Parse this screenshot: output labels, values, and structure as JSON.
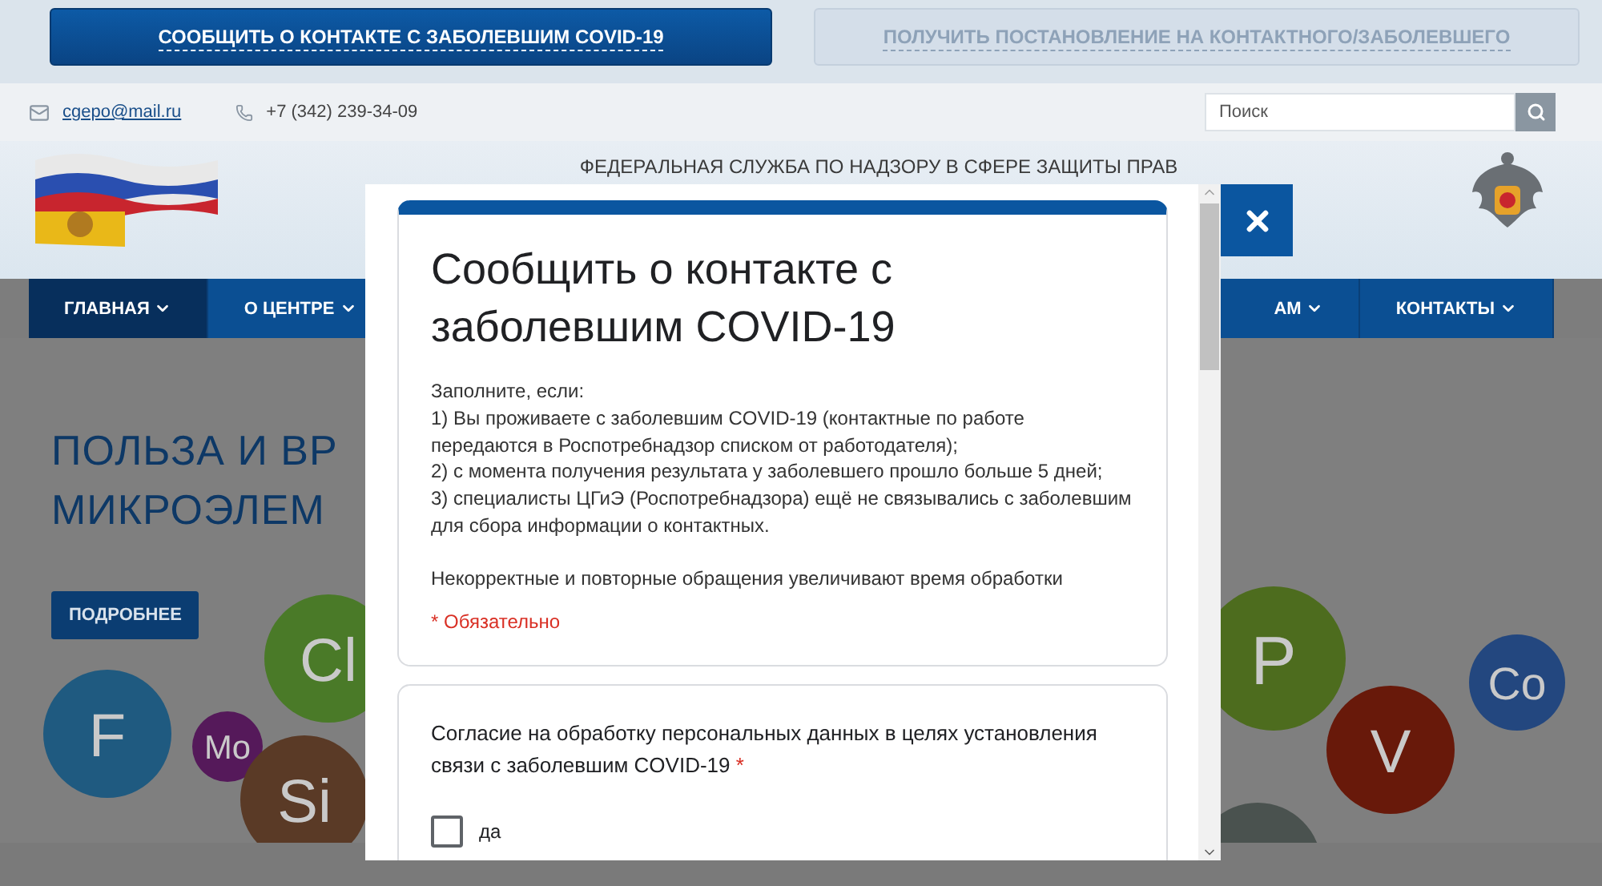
{
  "top_buttons": [
    {
      "label": "СООБЩИТЬ О КОНТАКТЕ С ЗАБОЛЕВШИМ COVID-19",
      "selected": true
    },
    {
      "label": "ПОЛУЧИТЬ ПОСТАНОВЛЕНИЕ НА КОНТАКТНОГО/ЗАБОЛЕВШЕГО",
      "selected": false
    }
  ],
  "contacts": {
    "email": "cgepo@mail.ru",
    "phone": "+7 (342) 239-34-09"
  },
  "search": {
    "placeholder": "Поиск"
  },
  "header": {
    "title": "ФЕДЕРАЛЬНАЯ СЛУЖБА ПО НАДЗОРУ В СФЕРЕ ЗАЩИТЫ ПРАВ"
  },
  "nav": {
    "items": [
      {
        "label": "ГЛАВНАЯ",
        "selected": true
      },
      {
        "label": "О ЦЕНТРЕ",
        "selected": false
      }
    ],
    "items_right": [
      {
        "label": "АМ",
        "selected": false
      },
      {
        "label": "КОНТАКТЫ",
        "selected": false
      }
    ]
  },
  "hero": {
    "title_lines": [
      "ПОЛЬЗА И ВР",
      "МИКРОЭЛЕМ"
    ],
    "button": "ПОДРОБНЕЕ",
    "bubbles": [
      {
        "label": "F",
        "color": "#1f5a80"
      },
      {
        "label": "Mo",
        "color": "#55195a"
      },
      {
        "label": "Cl",
        "color": "#4a7a28"
      },
      {
        "label": "Si",
        "color": "#5a3a26"
      },
      {
        "label": "P",
        "color": "#4d6c1e"
      },
      {
        "label": "V",
        "color": "#68190a"
      },
      {
        "label": "Co",
        "color": "#23477f"
      },
      {
        "color": "#4a524f"
      }
    ]
  },
  "modal": {
    "title": "Сообщить о контакте с заболевшим COVID-19",
    "description": [
      "Заполните, если:",
      "1) Вы проживаете с заболевшим COVID-19 (контактные по работе передаются в Роспотребнадзор списком от работодателя);",
      "2) с момента получения результата у заболевшего прошло больше 5 дней;",
      "3) специалисты ЦГиЭ (Роспотребнадзора) ещё не связывались с заболевшим для сбора информации о контактных."
    ],
    "note": "Некорректные и повторные обращения увеличивают время обработки",
    "required_note": "* Обязательно",
    "question": {
      "text": "Согласие на обработку персональных данных в целях установления связи с заболевшим COVID-19",
      "required_mark": "*",
      "options": [
        {
          "label": "да",
          "checked": false
        }
      ]
    }
  }
}
